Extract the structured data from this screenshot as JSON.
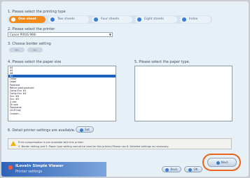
{
  "steps": {
    "s1": "1. Please select the printing type",
    "s2": "2. Please select the printer",
    "s3": "3. Choose border setting",
    "s4": "4. Please select the paper size",
    "s5": "5. Please select the paper type.",
    "s6": "6. Detail printer settings are available."
  },
  "tabs": [
    "One sheet",
    "Two sheets",
    "Four sheets",
    "Eight sheets",
    "Index"
  ],
  "printer": {
    "value": "Canon PIXUS 990i"
  },
  "border": {
    "opt1": "Yes",
    "opt2": "No"
  },
  "paper_sizes": [
    "A4",
    "A5",
    "A6",
    "B5",
    "Letter",
    "Legal",
    "Postcard",
    "Return paid postcard",
    "Comp Env. #1",
    "Comp Env. #4",
    "Env. #8",
    "Env. #9",
    "4 size",
    "DL size",
    "Panorama",
    "CD-R tray",
    "Custom..."
  ],
  "paper_size_selected": 3,
  "set_button": "Set",
  "info": {
    "line1": "Print compensation is not available with this printer.",
    "line2": "2. Border setting and 5. Paper type setting cannot be used on this printer.(Please use 6. Detailed settings as necessary."
  },
  "banner": {
    "title": "iLoveIn Simple Viewer",
    "subtitle": "Printer settings"
  },
  "buttons": {
    "back": "Back",
    "ok": "OK",
    "next": "Next"
  }
}
